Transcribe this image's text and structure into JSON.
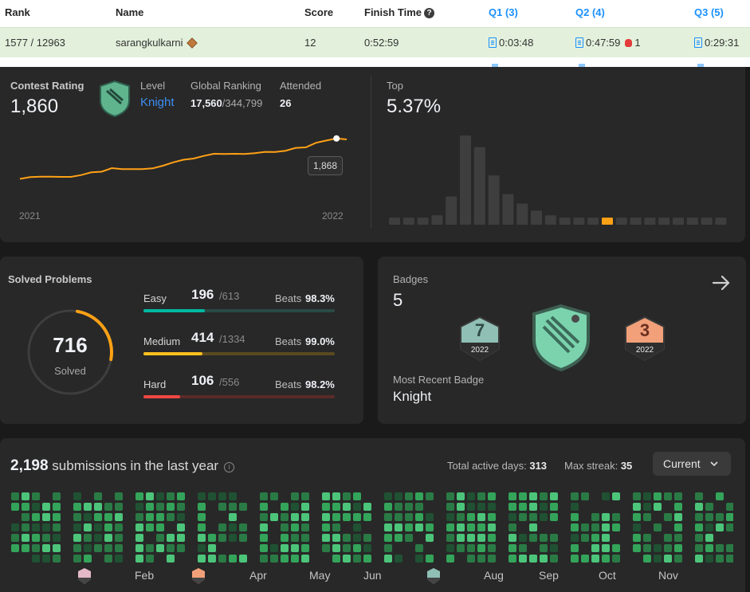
{
  "table": {
    "headers": {
      "rank": "Rank",
      "name": "Name",
      "score": "Score",
      "finish_time": "Finish Time",
      "q1": "Q1 (3)",
      "q2": "Q2 (4)",
      "q3": "Q3 (5)"
    },
    "row": {
      "rank": "1577 / 12963",
      "name": "sarangkulkarni",
      "score": "12",
      "finish_time": "0:52:59",
      "q1": "0:03:48",
      "q2": "0:47:59",
      "q2_bugs": "1",
      "q3": "0:29:31"
    }
  },
  "rating": {
    "title": "Contest Rating",
    "value": "1,860",
    "level_label": "Level",
    "level_value": "Knight",
    "global_label": "Global Ranking",
    "global_value": "17,560",
    "global_total": "/344,799",
    "attended_label": "Attended",
    "attended_value": "26",
    "tooltip": "1,868",
    "x_start": "2021",
    "x_end": "2022",
    "top_label": "Top",
    "top_value": "5.37%",
    "line_points": [
      1530,
      1545,
      1548,
      1548,
      1547,
      1547,
      1562,
      1585,
      1590,
      1620,
      1612,
      1612,
      1612,
      1618,
      1640,
      1668,
      1690,
      1700,
      1722,
      1740,
      1738,
      1740,
      1738,
      1745,
      1756,
      1755,
      1765,
      1789,
      1794,
      1832,
      1851,
      1868,
      1860
    ],
    "histogram": [
      3,
      3,
      3,
      4,
      12,
      38,
      33,
      21,
      13,
      9,
      6,
      4,
      3,
      3,
      3,
      3,
      3,
      3,
      3,
      3,
      3,
      3,
      3,
      3
    ],
    "histogram_highlight_index": 15,
    "accent": "#ffa116"
  },
  "solved": {
    "title": "Solved Problems",
    "total": "716",
    "total_label": "Solved",
    "rows": [
      {
        "name": "Easy",
        "solved": "196",
        "total": "/613",
        "beats_label": "Beats",
        "beats": "98.3%",
        "fraction": 0.32,
        "color": "#00b8a3",
        "track": "#2a4a45"
      },
      {
        "name": "Medium",
        "solved": "414",
        "total": "/1334",
        "beats_label": "Beats",
        "beats": "99.0%",
        "fraction": 0.31,
        "color": "#ffc01e",
        "track": "#5a4a20"
      },
      {
        "name": "Hard",
        "solved": "106",
        "total": "/556",
        "beats_label": "Beats",
        "beats": "98.2%",
        "fraction": 0.19,
        "color": "#ef4743",
        "track": "#5a2a2a"
      }
    ],
    "ring_fraction": 0.25
  },
  "badges": {
    "title": "Badges",
    "count": "5",
    "recent_label": "Most Recent Badge",
    "recent_value": "Knight",
    "badge_left_num": "7",
    "badge_left_year": "2022",
    "badge_right_num": "3",
    "badge_right_year": "2022"
  },
  "submissions": {
    "count": "2,198",
    "text": "submissions in the last year",
    "active_label": "Total active days:",
    "active_value": "313",
    "streak_label": "Max streak:",
    "streak_value": "35",
    "select_value": "Current",
    "months": [
      "Feb",
      "Apr",
      "May",
      "Jun",
      "Aug",
      "Sep",
      "Oct",
      "Nov"
    ]
  }
}
